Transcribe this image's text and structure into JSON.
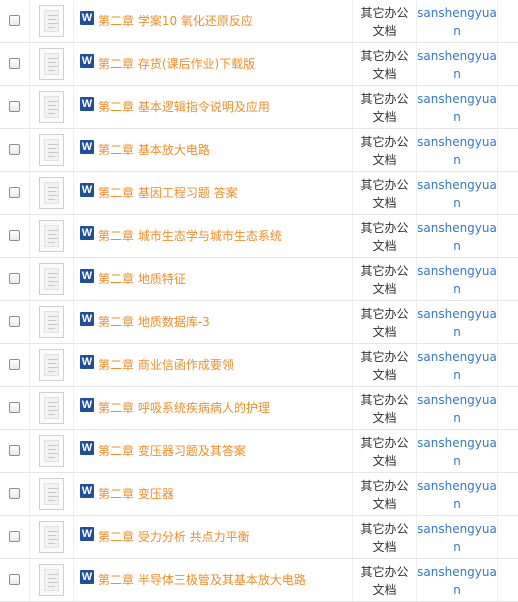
{
  "rows": [
    {
      "title": "第二章 学案10 氧化还原反应",
      "category_line1": "其它办公",
      "category_line2": "文档",
      "user_line1": "sanshengyua",
      "user_line2": "n"
    },
    {
      "title": "第二章 存货(课后作业)下载版",
      "category_line1": "其它办公",
      "category_line2": "文档",
      "user_line1": "sanshengyua",
      "user_line2": "n"
    },
    {
      "title": "第二章 基本逻辑指令说明及应用",
      "category_line1": "其它办公",
      "category_line2": "文档",
      "user_line1": "sanshengyua",
      "user_line2": "n"
    },
    {
      "title": "第二章 基本放大电路",
      "category_line1": "其它办公",
      "category_line2": "文档",
      "user_line1": "sanshengyua",
      "user_line2": "n"
    },
    {
      "title": "第二章 基因工程习题 答案",
      "category_line1": "其它办公",
      "category_line2": "文档",
      "user_line1": "sanshengyua",
      "user_line2": "n"
    },
    {
      "title": "第二章 城市生态学与城市生态系统",
      "category_line1": "其它办公",
      "category_line2": "文档",
      "user_line1": "sanshengyua",
      "user_line2": "n"
    },
    {
      "title": "第二章 地质特征",
      "category_line1": "其它办公",
      "category_line2": "文档",
      "user_line1": "sanshengyua",
      "user_line2": "n"
    },
    {
      "title": "第二章 地质数据库-3",
      "category_line1": "其它办公",
      "category_line2": "文档",
      "user_line1": "sanshengyua",
      "user_line2": "n"
    },
    {
      "title": "第二章 商业信函作成要领",
      "category_line1": "其它办公",
      "category_line2": "文档",
      "user_line1": "sanshengyua",
      "user_line2": "n"
    },
    {
      "title": "第二章 呼吸系统疾病病人的护理",
      "category_line1": "其它办公",
      "category_line2": "文档",
      "user_line1": "sanshengyua",
      "user_line2": "n"
    },
    {
      "title": "第二章 变压器习题及其答案",
      "category_line1": "其它办公",
      "category_line2": "文档",
      "user_line1": "sanshengyua",
      "user_line2": "n"
    },
    {
      "title": "第二章 变压器",
      "category_line1": "其它办公",
      "category_line2": "文档",
      "user_line1": "sanshengyua",
      "user_line2": "n"
    },
    {
      "title": "第二章 受力分析 共点力平衡",
      "category_line1": "其它办公",
      "category_line2": "文档",
      "user_line1": "sanshengyua",
      "user_line2": "n"
    },
    {
      "title": "第二章 半导体三极管及其基本放大电路",
      "category_line1": "其它办公",
      "category_line2": "文档",
      "user_line1": "sanshengyua",
      "user_line2": "n"
    }
  ],
  "icons": {
    "file_type": "word-icon",
    "file_type_letter": "W",
    "thumbnail": "document-thumbnail-icon"
  },
  "colors": {
    "title_link": "#ee8e26",
    "user_link": "#3578c7",
    "word_icon": "#1e4e9c"
  }
}
